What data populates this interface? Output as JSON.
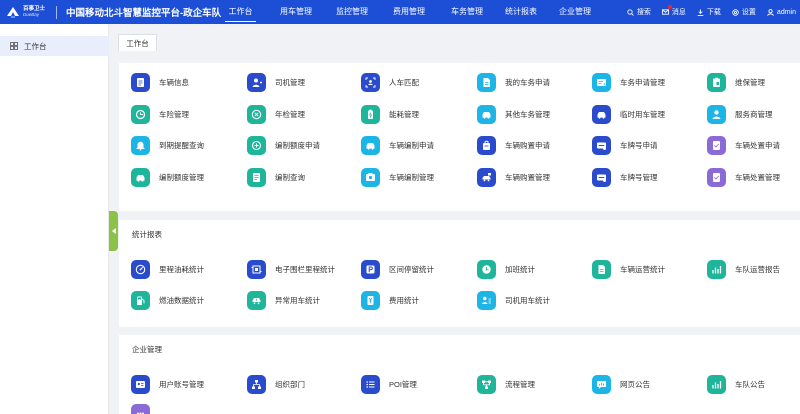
{
  "header": {
    "logo_line1": "百事卫士",
    "logo_line2": "DueBay",
    "title": "中国移动北斗智慧监控平台-政企车队",
    "nav": [
      {
        "label": "工作台",
        "active": true
      },
      {
        "label": "用车管理",
        "active": false
      },
      {
        "label": "监控管理",
        "active": false
      },
      {
        "label": "费用管理",
        "active": false
      },
      {
        "label": "车务管理",
        "active": false
      },
      {
        "label": "统计报表",
        "active": false
      },
      {
        "label": "企业管理",
        "active": false
      }
    ],
    "search": "搜索",
    "messages": "消息",
    "download": "下载",
    "settings": "设置",
    "user": "admin"
  },
  "sidebar": {
    "items": [
      {
        "label": "工作台",
        "icon": "grid-icon"
      }
    ]
  },
  "tabs": [
    {
      "label": "工作台"
    }
  ],
  "colors": {
    "header": "#1d4fd6",
    "navy": "#2a4bcc",
    "cyan": "#1cb5e6",
    "teal": "#1fb59a",
    "purple": "#8a6bd6",
    "green_tab": "#8bc34a"
  },
  "sections": [
    {
      "title": "",
      "items": [
        {
          "label": "车辆信息",
          "icon": "document-icon",
          "color": "#2a4bcc"
        },
        {
          "label": "司机管理",
          "icon": "user-add-icon",
          "color": "#2a4bcc"
        },
        {
          "label": "人车匹配",
          "icon": "scan-icon",
          "color": "#2a4bcc"
        },
        {
          "label": "我的车务申请",
          "icon": "file-icon",
          "color": "#1cb5e6"
        },
        {
          "label": "车务申请管理",
          "icon": "list-card-icon",
          "color": "#1cb5e6"
        },
        {
          "label": "维保管理",
          "icon": "clipboard-icon",
          "color": "#1fb59a"
        },
        {
          "label": "车险管理",
          "icon": "shield-icon",
          "color": "#1fb59a"
        },
        {
          "label": "年检管理",
          "icon": "badge-icon",
          "color": "#1fb59a"
        },
        {
          "label": "能耗管理",
          "icon": "battery-icon",
          "color": "#1fb59a"
        },
        {
          "label": "其他车务管理",
          "icon": "car-icon",
          "color": "#1cb5e6"
        },
        {
          "label": "临时用车管理",
          "icon": "car-icon",
          "color": "#2a4bcc"
        },
        {
          "label": "服务商管理",
          "icon": "user-icon",
          "color": "#1cb5e6"
        },
        {
          "label": "到期提醒查询",
          "icon": "bell-icon",
          "color": "#1cb5e6"
        },
        {
          "label": "编制额度申请",
          "icon": "quota-icon",
          "color": "#1fb59a"
        },
        {
          "label": "车辆编制申请",
          "icon": "car-icon",
          "color": "#1cb5e6"
        },
        {
          "label": "车辆购置申请",
          "icon": "bag-icon",
          "color": "#2a4bcc"
        },
        {
          "label": "车牌号申请",
          "icon": "plate-icon",
          "color": "#2a4bcc"
        },
        {
          "label": "车辆处置申请",
          "icon": "check-doc-icon",
          "color": "#8a6bd6"
        },
        {
          "label": "编制额度管理",
          "icon": "car-icon",
          "color": "#1fb59a"
        },
        {
          "label": "编制查询",
          "icon": "doc-list-icon",
          "color": "#1fb59a"
        },
        {
          "label": "车辆编制管理",
          "icon": "photo-icon",
          "color": "#1cb5e6"
        },
        {
          "label": "车辆购置管理",
          "icon": "car-bag-icon",
          "color": "#2a4bcc"
        },
        {
          "label": "车牌号管理",
          "icon": "plate-icon",
          "color": "#2a4bcc"
        },
        {
          "label": "车辆处置管理",
          "icon": "check-doc-icon",
          "color": "#8a6bd6"
        }
      ]
    },
    {
      "title": "统计报表",
      "items": [
        {
          "label": "里程油耗统计",
          "icon": "gauge-icon",
          "color": "#2a4bcc"
        },
        {
          "label": "电子围栏里程统计",
          "icon": "fence-icon",
          "color": "#2a4bcc"
        },
        {
          "label": "区间停留统计",
          "icon": "parking-icon",
          "color": "#2a4bcc"
        },
        {
          "label": "加班统计",
          "icon": "clock-icon",
          "color": "#1fb59a"
        },
        {
          "label": "车辆运营统计",
          "icon": "file-icon",
          "color": "#1fb59a"
        },
        {
          "label": "车队运营报告",
          "icon": "bar-chart-icon",
          "color": "#1fb59a"
        },
        {
          "label": "燃油数据统计",
          "icon": "fuel-icon",
          "color": "#1fb59a"
        },
        {
          "label": "异常用车统计",
          "icon": "alert-car-icon",
          "color": "#1fb59a"
        },
        {
          "label": "费用统计",
          "icon": "yen-icon",
          "color": "#1cb5e6"
        },
        {
          "label": "司机用车统计",
          "icon": "user-list-icon",
          "color": "#1cb5e6"
        }
      ]
    },
    {
      "title": "企业管理",
      "items": [
        {
          "label": "用户账号管理",
          "icon": "id-card-icon",
          "color": "#2a4bcc"
        },
        {
          "label": "组织部门",
          "icon": "org-icon",
          "color": "#2a4bcc"
        },
        {
          "label": "POI管理",
          "icon": "list-icon",
          "color": "#2a4bcc"
        },
        {
          "label": "流程管理",
          "icon": "flow-icon",
          "color": "#1fb59a"
        },
        {
          "label": "网页公告",
          "icon": "chart-bubble-icon",
          "color": "#1cb5e6"
        },
        {
          "label": "车队公告",
          "icon": "bar-chart-icon",
          "color": "#1fb59a"
        },
        {
          "label": "",
          "icon": "more-icon",
          "color": "#8a6bd6"
        }
      ]
    }
  ]
}
